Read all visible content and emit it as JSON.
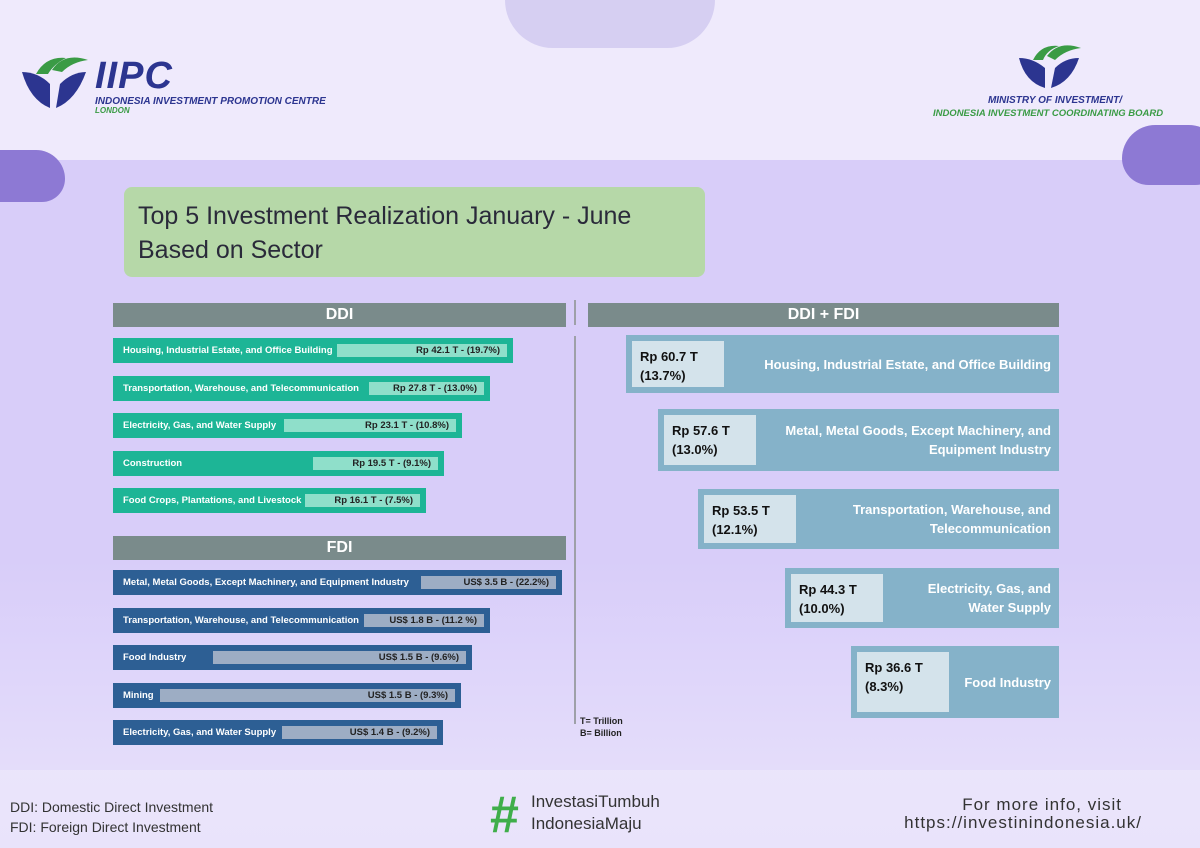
{
  "header": {
    "iipc_title": "IIPC",
    "iipc_subtitle": "INDONESIA INVESTMENT PROMOTION CENTRE",
    "iipc_city": "LONDON",
    "ministry_line1": "MINISTRY OF INVESTMENT/",
    "ministry_line2": "INDONESIA INVESTMENT COORDINATING BOARD"
  },
  "colors": {
    "ddi": "#1db596",
    "fdi": "#2d5f94",
    "combined": "#85b2c9",
    "title_box": "#b6d8a8"
  },
  "chart_data": [
    {
      "type": "bar",
      "title": "DDI",
      "orientation": "horizontal",
      "unit": "Rp T",
      "categories": [
        "Housing, Industrial Estate, and Office Building",
        "Transportation, Warehouse, and Telecommunication",
        "Electricity, Gas, and Water Supply",
        "Construction",
        "Food Crops, Plantations, and Livestock"
      ],
      "values": [
        42.1,
        27.8,
        23.1,
        19.5,
        16.1
      ],
      "shares_percent": [
        19.7,
        13.0,
        10.8,
        9.1,
        7.5
      ],
      "data_labels": [
        "Rp 42.1 T - (19.7%)",
        "Rp 27.8 T - (13.0%)",
        "Rp 23.1 T - (10.8%)",
        "Rp 19.5 T - (9.1%)",
        "Rp 16.1 T - (7.5%)"
      ]
    },
    {
      "type": "bar",
      "title": "FDI",
      "orientation": "horizontal",
      "unit": "US$ B",
      "categories": [
        "Metal, Metal Goods, Except Machinery, and Equipment Industry",
        "Transportation, Warehouse, and Telecommunication",
        "Food Industry",
        "Mining",
        "Electricity, Gas, and Water Supply"
      ],
      "values": [
        3.5,
        1.8,
        1.5,
        1.5,
        1.4
      ],
      "shares_percent": [
        22.2,
        11.2,
        9.6,
        9.3,
        9.2
      ],
      "data_labels": [
        "US$ 3.5 B - (22.2%)",
        "US$ 1.8 B - (11.2 %)",
        "US$ 1.5 B - (9.6%)",
        "US$ 1.5 B - (9.3%)",
        "US$ 1.4 B - (9.2%)"
      ]
    },
    {
      "type": "bar",
      "title": "DDI + FDI",
      "orientation": "horizontal",
      "unit": "Rp T",
      "categories": [
        "Housing, Industrial Estate, and Office Building",
        "Metal, Metal Goods, Except Machinery, and Equipment Industry",
        "Transportation, Warehouse, and Telecommunication",
        "Electricity, Gas, and Water Supply",
        "Food Industry"
      ],
      "values": [
        60.7,
        57.6,
        53.5,
        44.3,
        36.6
      ],
      "shares_percent": [
        13.7,
        13.0,
        12.1,
        10.0,
        8.3
      ],
      "value_labels": [
        "Rp 60.7 T",
        "Rp 57.6 T",
        "Rp 53.5 T",
        "Rp 44.3 T",
        "Rp 36.6 T"
      ],
      "share_labels": [
        "(13.7%)",
        "(13.0%)",
        "(12.1%)",
        "(10.0%)",
        "(8.3%)"
      ]
    }
  ],
  "main": {
    "title": "Top 5 Investment Realization January - June Based on Sector",
    "unit_note_1": "T= Trillion",
    "unit_note_2": "B= Billion"
  },
  "footer": {
    "def_ddi": "DDI: Domestic Direct Investment",
    "def_fdi": "FDI: Foreign Direct Investment",
    "hashtag_symbol": "#",
    "hashtag_line1": "InvestasiTumbuh",
    "hashtag_line2": "IndonesiaMaju",
    "more_info": "For more info, visit",
    "url": "https://investinindonesia.uk/"
  }
}
